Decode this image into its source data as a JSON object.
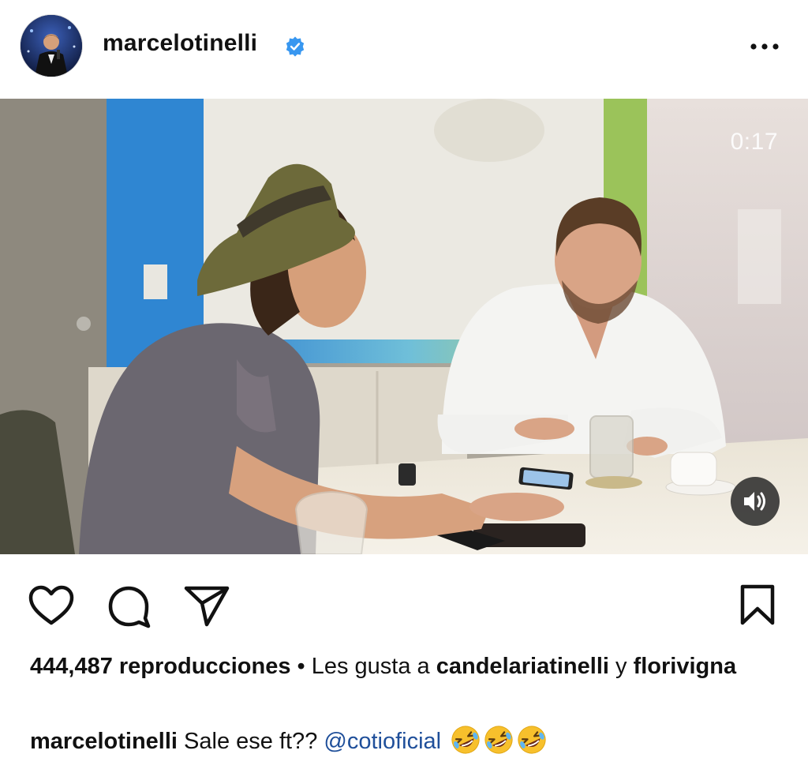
{
  "post": {
    "username": "marcelotinelli",
    "verified": true,
    "video_timer": "0:17"
  },
  "stats": {
    "views_count": "444,487",
    "views_label": "reproducciones",
    "separator": "•",
    "liked_by_prefix": "Les gusta a",
    "liked_by_user": "candelariatinelli",
    "liked_by_joiner": "y",
    "liked_by_other": "florivigna"
  },
  "caption": {
    "username": "marcelotinelli",
    "text": "Sale ese ft??",
    "mention": "@cotioficial",
    "emoji_count": 3
  },
  "icons": [
    "avatar",
    "verified-badge-icon",
    "more-options-icon",
    "volume-icon",
    "heart-icon",
    "comment-icon",
    "share-icon",
    "bookmark-icon",
    "rofl-emoji-icon"
  ],
  "colors": {
    "verified_blue": "#3897f0",
    "mention_blue": "#1f4f9a",
    "text": "#111111"
  }
}
